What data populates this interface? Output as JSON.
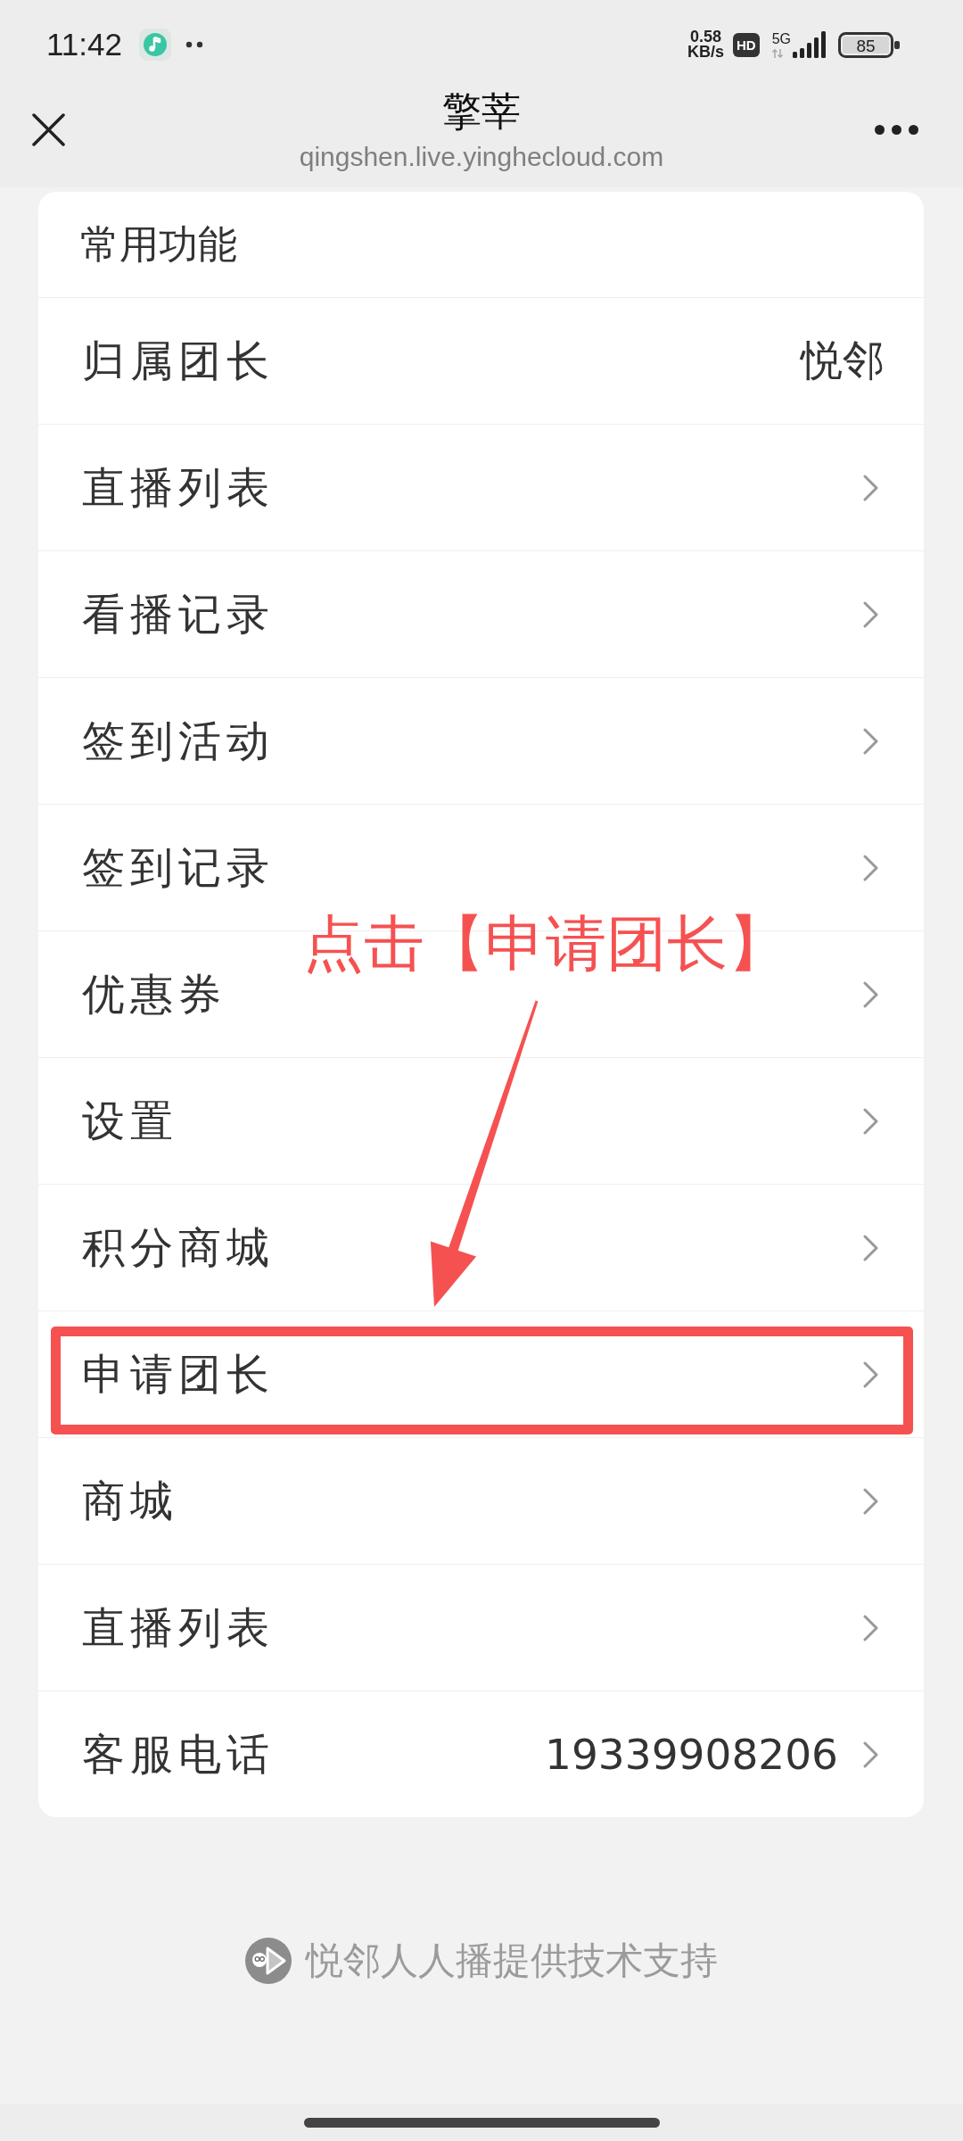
{
  "status_bar": {
    "time": "11:42",
    "net_speed": "0.58",
    "net_speed_unit": "KB/s",
    "hd_badge": "HD",
    "network_type": "5G",
    "battery": "85"
  },
  "header": {
    "title": "擎莘",
    "url": "qingshen.live.yinghecloud.com"
  },
  "menu": {
    "title": "常用功能",
    "items": [
      {
        "label": "归属团长",
        "value": "悦邻",
        "chevron": false,
        "highlighted": false
      },
      {
        "label": "直播列表",
        "chevron": true,
        "highlighted": false
      },
      {
        "label": "看播记录",
        "chevron": true,
        "highlighted": false
      },
      {
        "label": "签到活动",
        "chevron": true,
        "highlighted": false
      },
      {
        "label": "签到记录",
        "chevron": true,
        "highlighted": false
      },
      {
        "label": "优惠券",
        "chevron": true,
        "highlighted": false
      },
      {
        "label": "设置",
        "chevron": true,
        "highlighted": false
      },
      {
        "label": "积分商城",
        "chevron": true,
        "highlighted": false
      },
      {
        "label": "申请团长",
        "chevron": true,
        "highlighted": true
      },
      {
        "label": "商城",
        "chevron": true,
        "highlighted": false
      },
      {
        "label": "直播列表",
        "chevron": true,
        "highlighted": false
      },
      {
        "label": "客服电话",
        "value": "19339908206",
        "chevron": true,
        "highlighted": false
      }
    ]
  },
  "annotation": {
    "text": "点击【申请团长】"
  },
  "footer": {
    "text": "悦邻人人播提供技术支持"
  }
}
